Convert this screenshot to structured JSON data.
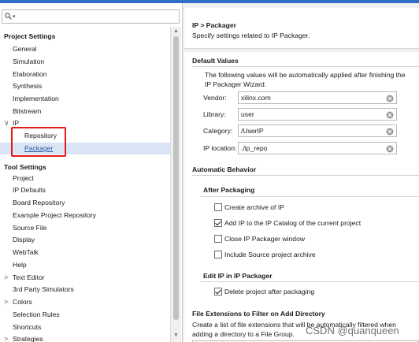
{
  "search": {
    "glyph": "▾"
  },
  "tree": {
    "project_settings": "Project Settings",
    "items_project": [
      "General",
      "Simulation",
      "Elaboration",
      "Synthesis",
      "Implementation",
      "Bitstream"
    ],
    "ip": {
      "label": "IP",
      "expander": "∨"
    },
    "ip_children": [
      "Repository",
      "Packager"
    ],
    "tool_settings": "Tool Settings",
    "items_tool": [
      {
        "label": "Project",
        "expander": ""
      },
      {
        "label": "IP Defaults",
        "expander": ""
      },
      {
        "label": "Board Repository",
        "expander": ""
      },
      {
        "label": "Example Project Repository",
        "expander": ""
      },
      {
        "label": "Source File",
        "expander": ""
      },
      {
        "label": "Display",
        "expander": ""
      },
      {
        "label": "WebTalk",
        "expander": ""
      },
      {
        "label": "Help",
        "expander": ""
      },
      {
        "label": "Text Editor",
        "expander": ">"
      },
      {
        "label": "3rd Party Simulators",
        "expander": ""
      },
      {
        "label": "Colors",
        "expander": ">"
      },
      {
        "label": "Selection Rules",
        "expander": ""
      },
      {
        "label": "Shortcuts",
        "expander": ""
      },
      {
        "label": "Strategies",
        "expander": ">"
      }
    ],
    "scroll_up": "▲",
    "scroll_down": "▼"
  },
  "header": {
    "title": "IP > Packager",
    "subtitle": "Specify settings related to IP Packager."
  },
  "default_values": {
    "title": "Default Values",
    "description": "The following values will be automatically applied after finishing the IP Packager Wizard.",
    "fields": [
      {
        "label": "Vendor:",
        "value": "xilinx.com"
      },
      {
        "label": "Library:",
        "value": "user"
      },
      {
        "label": "Category:",
        "value": "/UserIP"
      },
      {
        "label": "IP location:",
        "value": "./ip_repo"
      }
    ]
  },
  "automatic_behavior": {
    "title": "Automatic Behavior",
    "after_packaging": {
      "title": "After Packaging",
      "options": [
        {
          "label": "Create archive of IP",
          "checked": false
        },
        {
          "label": "Add IP to the IP Catalog of the current project",
          "checked": true
        },
        {
          "label": "Close IP Packager window",
          "checked": false
        },
        {
          "label": "Include Source project archive",
          "checked": false
        }
      ]
    },
    "edit_ip": {
      "title": "Edit IP in IP Packager",
      "options": [
        {
          "label": "Delete project after packaging",
          "checked": true
        }
      ]
    }
  },
  "file_extensions": {
    "title": "File Extensions to Filter on Add Directory",
    "description": "Create a list of file extensions that will be automatically filtered when adding a directory to a File Group."
  },
  "watermark": "CSDN @quanqueen",
  "colors": {
    "accent": "#2f6fc4",
    "selection": "#d9e4f5",
    "highlight_box": "#e21b1b"
  }
}
